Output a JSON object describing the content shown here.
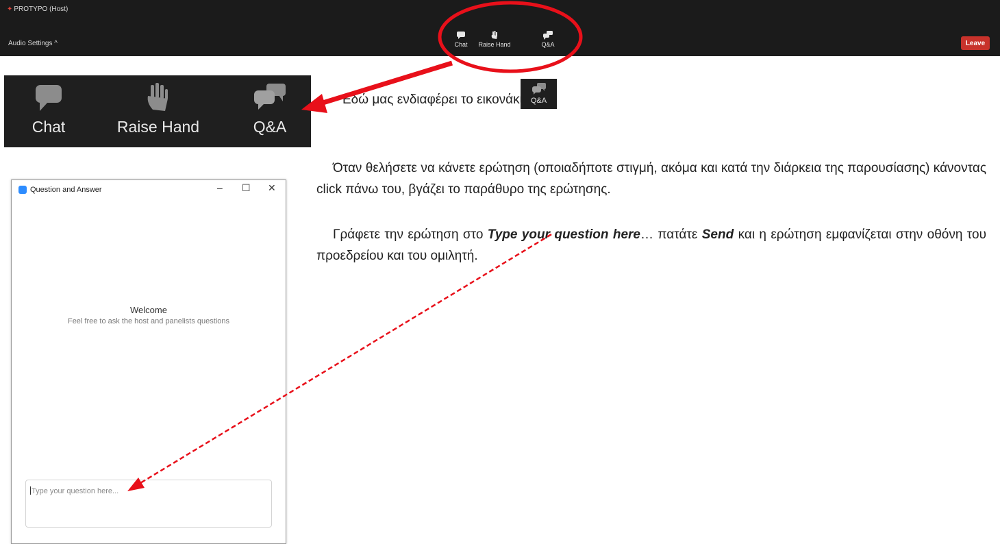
{
  "toolbar": {
    "host_name": "PROTYPO (Host)",
    "audio_settings": "Audio Settings ^",
    "buttons": [
      {
        "label": "Chat",
        "icon": "chat-bubble-icon"
      },
      {
        "label": "Raise Hand",
        "icon": "raised-hand-icon"
      },
      {
        "label": "Q&A",
        "icon": "qa-bubbles-icon"
      }
    ],
    "leave_label": "Leave",
    "leave_color": "#c8322b"
  },
  "zoomed_toolbar": {
    "buttons": [
      {
        "label": "Chat",
        "icon": "chat-bubble-icon"
      },
      {
        "label": "Raise Hand",
        "icon": "raised-hand-icon"
      },
      {
        "label": "Q&A",
        "icon": "qa-bubbles-icon"
      }
    ]
  },
  "instructions": {
    "heading": "Εδώ μας ενδιαφέρει το εικονάκι",
    "qa_icon_label": "Q&A",
    "para1": "Όταν θελήσετε να κάνετε ερώτηση (οποιαδήποτε στιγμή, ακόμα και κατά την διάρκεια της παρουσίασης) κάνοντας click πάνω του, βγάζει το παράθυρο της ερώτησης.",
    "para2_before": "Γράφετε την ερώτηση στο ",
    "para2_bold1": "Type your question here",
    "para2_mid": "… πατάτε ",
    "para2_bold2": "Send",
    "para2_after": " και η ερώτηση εμφανίζεται στην οθόνη του προεδρείου και του ομιλητή."
  },
  "qa_window": {
    "title": "Question and Answer",
    "minimize": "–",
    "maximize": "☐",
    "close": "✕",
    "welcome_title": "Welcome",
    "welcome_subtitle": "Feel free to ask the host and panelists questions",
    "input_placeholder": "Type your question here..."
  },
  "colors": {
    "annotation_red": "#e8101a",
    "toolbar_bg": "#1b1b1b"
  }
}
